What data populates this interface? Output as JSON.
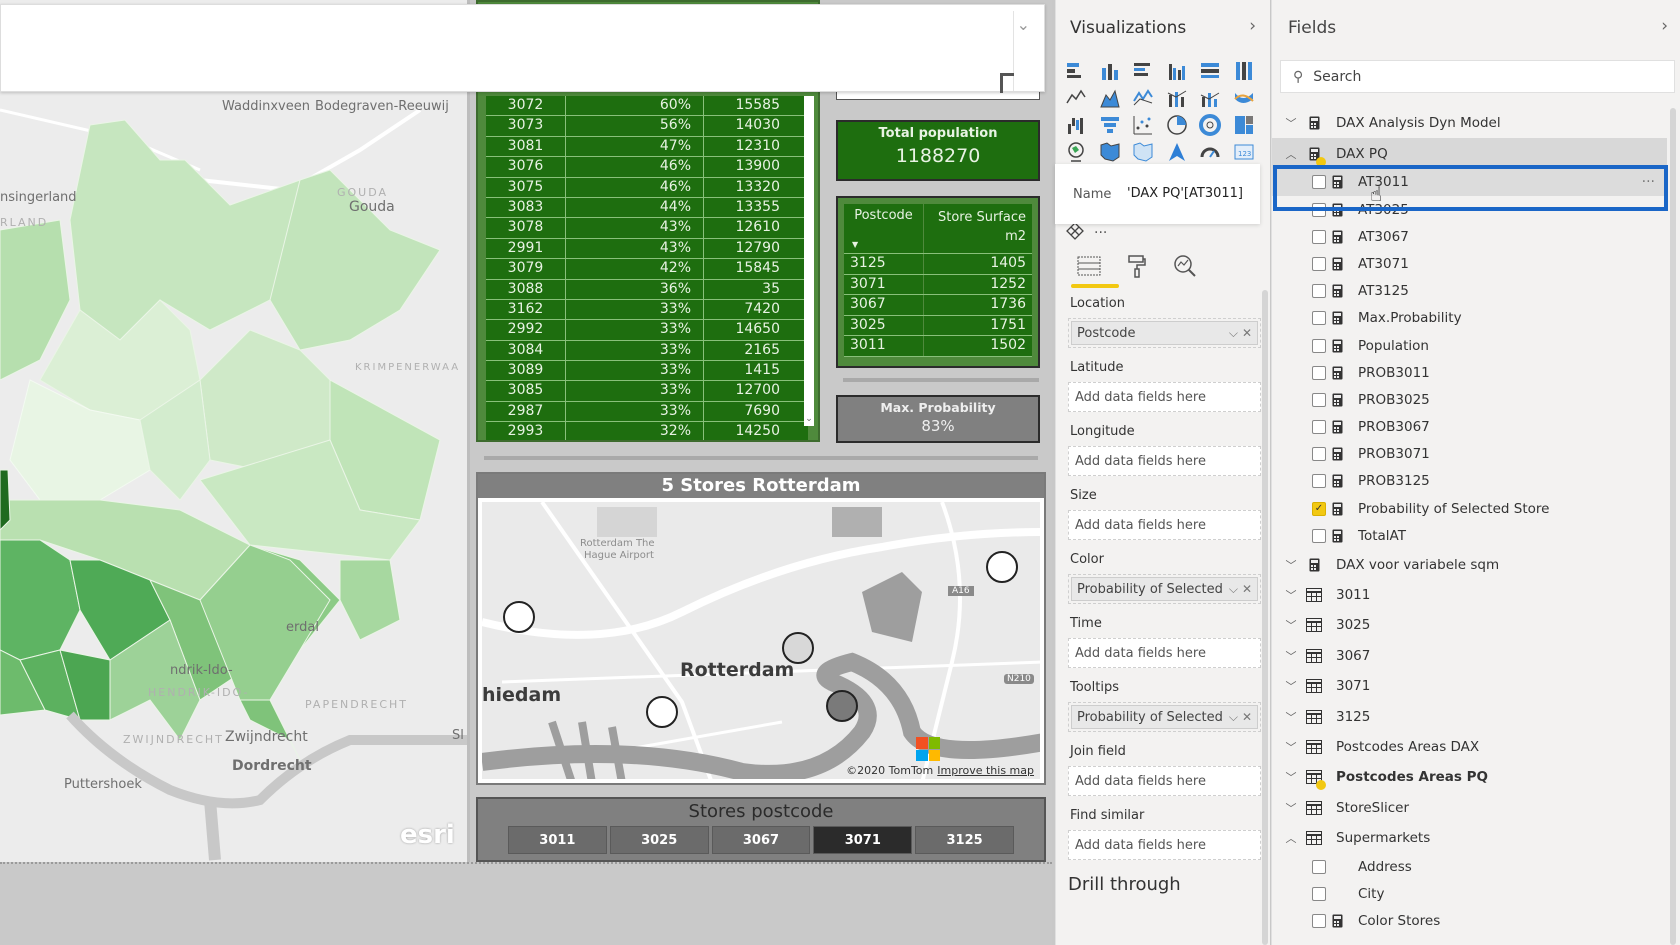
{
  "choropleth_map": {
    "labels": {
      "waddinxveen": "Waddinxveen",
      "bodegraven": "Bodegraven-Reeuwij",
      "gouda_caps": "GOUDA",
      "gouda": "Gouda",
      "lansingerland": "nsingerland",
      "lansingerland_caps": "RLAND",
      "krimpenerwaard": "KRIMPENERWAA",
      "hendrik_ido": "ndrik-Ido-",
      "hendrik_ido_caps": "HENDRIK-IDO-",
      "papendrecht": "PAPENDRECHT",
      "zwijndrecht_caps": "ZWIJNDRECHT",
      "zwijndrecht": "Zwijndrecht",
      "dordrecht": "Dordrecht",
      "puttershoek": "Puttershoek",
      "ridderkerk_partial": "erdal",
      "sliedrecht_partial": "Sl"
    },
    "logo": "esri"
  },
  "population_table": {
    "rows": [
      {
        "postcode": "3072",
        "probability": "60%",
        "population": "15585"
      },
      {
        "postcode": "3073",
        "probability": "56%",
        "population": "14030"
      },
      {
        "postcode": "3081",
        "probability": "47%",
        "population": "12310"
      },
      {
        "postcode": "3076",
        "probability": "46%",
        "population": "13900"
      },
      {
        "postcode": "3075",
        "probability": "46%",
        "population": "13320"
      },
      {
        "postcode": "3083",
        "probability": "44%",
        "population": "13355"
      },
      {
        "postcode": "3078",
        "probability": "43%",
        "population": "12610"
      },
      {
        "postcode": "2991",
        "probability": "43%",
        "population": "12790"
      },
      {
        "postcode": "3079",
        "probability": "42%",
        "population": "15845"
      },
      {
        "postcode": "3088",
        "probability": "36%",
        "population": "35"
      },
      {
        "postcode": "3162",
        "probability": "33%",
        "population": "7420"
      },
      {
        "postcode": "2992",
        "probability": "33%",
        "population": "14650"
      },
      {
        "postcode": "3084",
        "probability": "33%",
        "population": "2165"
      },
      {
        "postcode": "3089",
        "probability": "33%",
        "population": "1415"
      },
      {
        "postcode": "3085",
        "probability": "33%",
        "population": "12700"
      },
      {
        "postcode": "2987",
        "probability": "33%",
        "population": "7690"
      },
      {
        "postcode": "2993",
        "probability": "32%",
        "population": "14250"
      }
    ]
  },
  "total_population_card": {
    "label": "Total population",
    "value": "1188270"
  },
  "store_surface_table": {
    "headers": {
      "postcode": "Postcode",
      "surface": "Store Surface m2"
    },
    "rows": [
      {
        "postcode": "3125",
        "surface": "1405"
      },
      {
        "postcode": "3071",
        "surface": "1252"
      },
      {
        "postcode": "3067",
        "surface": "1736"
      },
      {
        "postcode": "3025",
        "surface": "1751"
      },
      {
        "postcode": "3011",
        "surface": "1502"
      }
    ]
  },
  "max_probability_card": {
    "label": "Max. Probability",
    "value": "83%"
  },
  "store_map": {
    "title": "5 Stores Rotterdam",
    "labels": {
      "airport_1": "Rotterdam The",
      "airport_2": "Hague Airport",
      "city": "Rotterdam",
      "schiedam": "hiedam",
      "a16": "A16",
      "n210": "N210",
      "microsoft": "Microsoft"
    },
    "attribution": "©2020 TomTom",
    "improve_link": "Improve this map"
  },
  "store_slicer": {
    "title": "Stores postcode",
    "options": [
      "3011",
      "3025",
      "3067",
      "3071",
      "3125"
    ],
    "selected": "3071"
  },
  "visualizations_pane": {
    "title": "Visualizations",
    "icons": [
      "stacked-bar-chart",
      "stacked-column-chart",
      "clustered-bar-chart",
      "clustered-column-chart",
      "100-stacked-bar-chart",
      "100-stacked-column-chart",
      "line-chart",
      "area-chart",
      "stacked-area-chart",
      "line-and-stacked-column-chart",
      "line-and-clustered-column-chart",
      "ribbon-chart",
      "waterfall-chart",
      "funnel-chart",
      "scatter-chart",
      "pie-chart",
      "donut-chart",
      "treemap",
      "map",
      "filled-map",
      "shape-map",
      "azure-map",
      "gauge",
      "card"
    ],
    "tooltip": {
      "key": "Name",
      "value": "'DAX PQ'[AT3011]"
    },
    "wells": [
      {
        "label": "Location",
        "value": "Postcode",
        "filled": true
      },
      {
        "label": "Latitude",
        "value": "Add data fields here",
        "filled": false
      },
      {
        "label": "Longitude",
        "value": "Add data fields here",
        "filled": false
      },
      {
        "label": "Size",
        "value": "Add data fields here",
        "filled": false
      },
      {
        "label": "Color",
        "value": "Probability of Selected Store",
        "filled": true
      },
      {
        "label": "Time",
        "value": "Add data fields here",
        "filled": false
      },
      {
        "label": "Tooltips",
        "value": "Probability of Selected Store",
        "filled": true
      },
      {
        "label": "Join field",
        "value": "Add data fields here",
        "filled": false
      },
      {
        "label": "Find similar",
        "value": "Add data fields here",
        "filled": false
      }
    ],
    "drill_through": "Drill through"
  },
  "fields_pane": {
    "title": "Fields",
    "search_placeholder": "Search",
    "tables": [
      {
        "name": "DAX Analysis Dyn Model",
        "type": "measure-table",
        "expanded": false
      },
      {
        "name": "DAX PQ",
        "type": "measure-table",
        "expanded": true,
        "active": true,
        "fields": [
          {
            "name": "AT3011",
            "checked": false,
            "hover": true
          },
          {
            "name": "AT3025",
            "checked": false
          },
          {
            "name": "AT3067",
            "checked": false
          },
          {
            "name": "AT3071",
            "checked": false
          },
          {
            "name": "AT3125",
            "checked": false
          },
          {
            "name": "Max.Probability",
            "checked": false
          },
          {
            "name": "Population",
            "checked": false
          },
          {
            "name": "PROB3011",
            "checked": false
          },
          {
            "name": "PROB3025",
            "checked": false
          },
          {
            "name": "PROB3067",
            "checked": false
          },
          {
            "name": "PROB3071",
            "checked": false
          },
          {
            "name": "PROB3125",
            "checked": false
          },
          {
            "name": "Probability of Selected Store",
            "checked": true
          },
          {
            "name": "TotalAT",
            "checked": false
          }
        ]
      },
      {
        "name": "DAX voor variabele sqm",
        "type": "measure-table",
        "expanded": false
      },
      {
        "name": "3011",
        "type": "table",
        "expanded": false
      },
      {
        "name": "3025",
        "type": "table",
        "expanded": false
      },
      {
        "name": "3067",
        "type": "table",
        "expanded": false
      },
      {
        "name": "3071",
        "type": "table",
        "expanded": false
      },
      {
        "name": "3125",
        "type": "table",
        "expanded": false
      },
      {
        "name": "Postcodes Areas DAX",
        "type": "table",
        "expanded": false
      },
      {
        "name": "Postcodes Areas PQ",
        "type": "table",
        "expanded": false,
        "active": true
      },
      {
        "name": "StoreSlicer",
        "type": "table",
        "expanded": false
      },
      {
        "name": "Supermarkets",
        "type": "table",
        "expanded": true,
        "fields": [
          {
            "name": "Address",
            "checked": false,
            "icon": false
          },
          {
            "name": "City",
            "checked": false,
            "icon": false
          },
          {
            "name": "Color Stores",
            "checked": false,
            "icon": true
          }
        ]
      }
    ]
  },
  "colors": {
    "table_green": "#1e6e0f",
    "accent_yellow": "#f2c811",
    "focus_blue": "#1a66c7",
    "slicer_selected": "#2b2b2b"
  }
}
